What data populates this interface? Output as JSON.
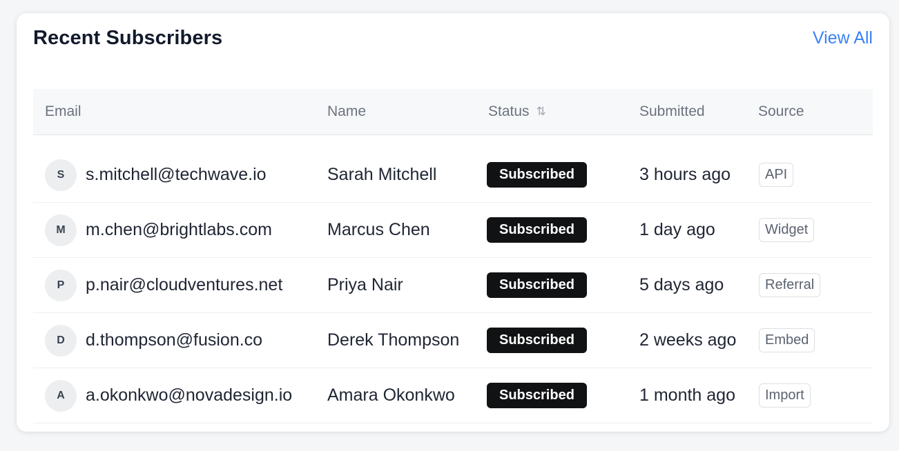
{
  "header": {
    "title": "Recent Subscribers",
    "view_all": "View All"
  },
  "columns": {
    "email": "Email",
    "name": "Name",
    "status": "Status",
    "submitted": "Submitted",
    "source": "Source"
  },
  "rows": [
    {
      "initial": "S",
      "email": "s.mitchell@techwave.io",
      "name": "Sarah Mitchell",
      "status": "Subscribed",
      "submitted": "3 hours ago",
      "source": "API"
    },
    {
      "initial": "M",
      "email": "m.chen@brightlabs.com",
      "name": "Marcus Chen",
      "status": "Subscribed",
      "submitted": "1 day ago",
      "source": "Widget"
    },
    {
      "initial": "P",
      "email": "p.nair@cloudventures.net",
      "name": "Priya Nair",
      "status": "Subscribed",
      "submitted": "5 days ago",
      "source": "Referral"
    },
    {
      "initial": "D",
      "email": "d.thompson@fusion.co",
      "name": "Derek Thompson",
      "status": "Subscribed",
      "submitted": "2 weeks ago",
      "source": "Embed"
    },
    {
      "initial": "A",
      "email": "a.okonkwo@novadesign.io",
      "name": "Amara Okonkwo",
      "status": "Subscribed",
      "submitted": "1 month ago",
      "source": "Import"
    }
  ],
  "icons": {
    "sort": "sort-arrows-icon"
  },
  "colors": {
    "accent": "#3b82f6",
    "badge_bg": "#111214"
  }
}
